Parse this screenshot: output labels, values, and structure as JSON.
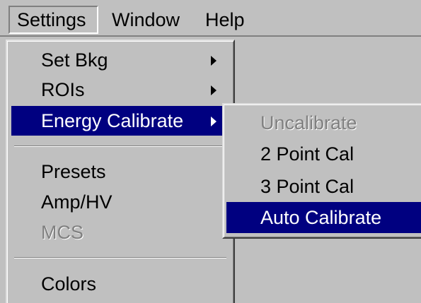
{
  "menubar": {
    "settings": "Settings",
    "window": "Window",
    "help": "Help"
  },
  "settings_menu": {
    "items": [
      {
        "label": "Set Bkg",
        "has_submenu": true
      },
      {
        "label": "ROIs",
        "has_submenu": true
      },
      {
        "label": "Energy Calibrate",
        "has_submenu": true,
        "highlighted": true
      },
      {
        "label": "Presets"
      },
      {
        "label": "Amp/HV"
      },
      {
        "label": "MCS",
        "disabled": true
      },
      {
        "label": "Colors"
      }
    ]
  },
  "energy_calibrate_submenu": {
    "items": [
      {
        "label": "Uncalibrate",
        "disabled": true
      },
      {
        "label": "2 Point Cal"
      },
      {
        "label": "3 Point Cal"
      },
      {
        "label": "Auto Calibrate",
        "highlighted": true
      }
    ]
  },
  "colors": {
    "menu_face": "#c0c0c0",
    "highlight": "#000080",
    "highlight_text": "#ffffff",
    "disabled_text": "#808080"
  }
}
